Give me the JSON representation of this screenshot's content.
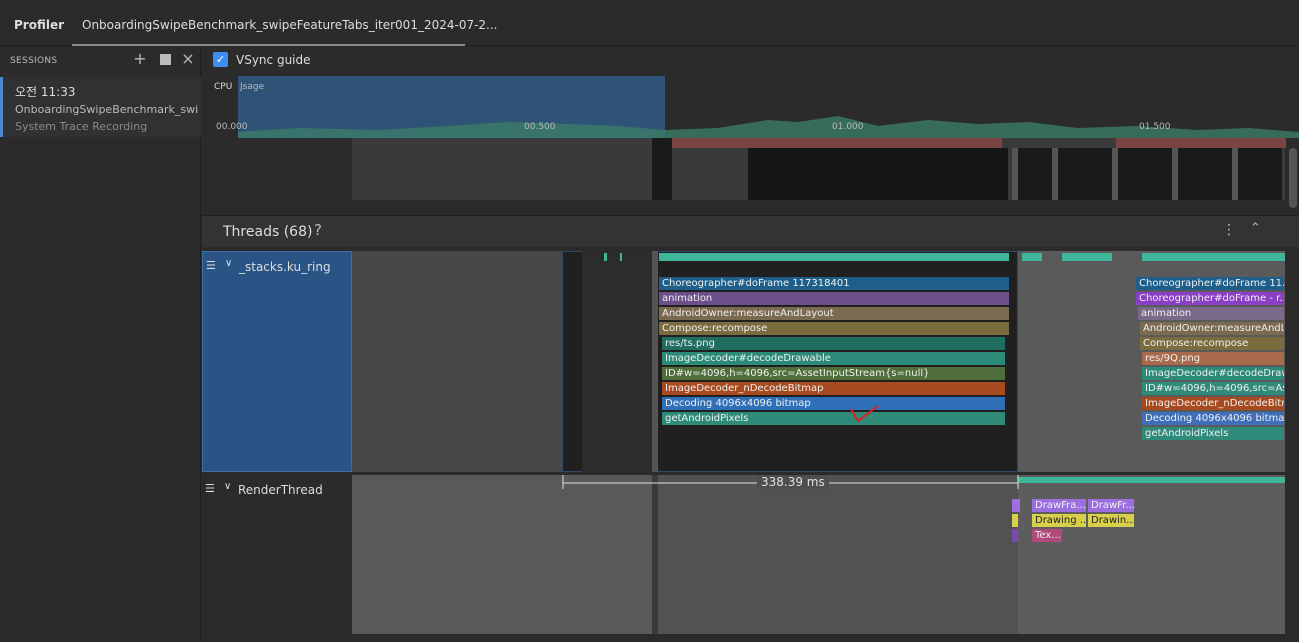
{
  "app": {
    "title": "Profiler",
    "tab_label": "OnboardingSwipeBenchmark_swipeFeatureTabs_iter001_2024-07-2..."
  },
  "sessions": {
    "title": "SESSIONS",
    "add_icon": "plus-icon",
    "stop_icon": "stop-icon",
    "close_icon": "close-icon",
    "item": {
      "time": "오전 11:33",
      "name": "OnboardingSwipeBenchmark_swip...",
      "type": "System Trace Recording"
    }
  },
  "vsync": {
    "label": "VSync guide",
    "checked": true
  },
  "cpu": {
    "label": "CPU",
    "usage": "Jsage",
    "ticks": [
      "00.000",
      "00.500",
      "01.000",
      "01.500"
    ]
  },
  "threads": {
    "title": "Threads (68)",
    "help": "?",
    "rows": [
      {
        "name": "_stacks.ku_ring"
      },
      {
        "name": "RenderThread"
      }
    ]
  },
  "slices_main": [
    "Choreographer#doFrame 117318401",
    "animation",
    "AndroidOwner:measureAndLayout",
    "Compose:recompose",
    "res/ts.png",
    "ImageDecoder#decodeDrawable",
    "ID#w=4096,h=4096,src=AssetInputStream{s=null}",
    "ImageDecoder_nDecodeBitmap",
    "Decoding 4096x4096 bitmap",
    "getAndroidPixels"
  ],
  "slices_right": [
    "Choreographer#doFrame 11...",
    "Choreographer#doFrame - r...",
    "animation",
    "AndroidOwner:measureAndL...",
    "Compose:recompose",
    "res/9Q.png",
    "ImageDecoder#decodeDraw...",
    "ID#w=4096,h=4096,src=Ass...",
    "ImageDecoder_nDecodeBitm...",
    "Decoding 4096x4096 bitmap",
    "getAndroidPixels"
  ],
  "render_slices": [
    "DrawFra...",
    "DrawFr...",
    "Drawing ...",
    "Drawin...",
    "Tex..."
  ],
  "measure": {
    "label": "338.39 ms"
  },
  "colors": {
    "selection": "#2b5486",
    "accent": "#3d8ef0",
    "teal": "#3fb59a"
  }
}
